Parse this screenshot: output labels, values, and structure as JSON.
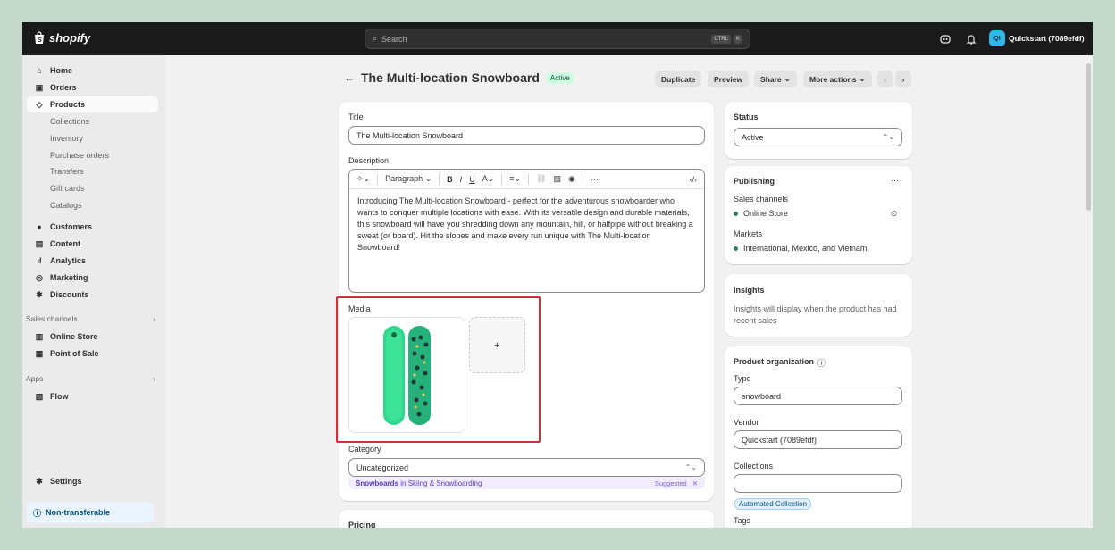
{
  "topbar": {
    "logo": "shopify",
    "search_placeholder": "Search",
    "shortcut_ctrl": "CTRL",
    "shortcut_k": "K",
    "store_initials": "QI",
    "store_name": "Quickstart (7089efdf)"
  },
  "sidebar": {
    "items": [
      {
        "label": "Home"
      },
      {
        "label": "Orders"
      },
      {
        "label": "Products"
      },
      {
        "label": "Collections"
      },
      {
        "label": "Inventory"
      },
      {
        "label": "Purchase orders"
      },
      {
        "label": "Transfers"
      },
      {
        "label": "Gift cards"
      },
      {
        "label": "Catalogs"
      },
      {
        "label": "Customers"
      },
      {
        "label": "Content"
      },
      {
        "label": "Analytics"
      },
      {
        "label": "Marketing"
      },
      {
        "label": "Discounts"
      }
    ],
    "sales_channels_label": "Sales channels",
    "channels": [
      "Online Store",
      "Point of Sale"
    ],
    "apps_label": "Apps",
    "apps": [
      "Flow"
    ],
    "settings": "Settings",
    "non_transferable": "Non-transferable"
  },
  "header": {
    "title": "The Multi-location Snowboard",
    "status_badge": "Active",
    "duplicate": "Duplicate",
    "preview": "Preview",
    "share": "Share",
    "more_actions": "More actions"
  },
  "product": {
    "title_label": "Title",
    "title_value": "The Multi-location Snowboard",
    "description_label": "Description",
    "toolbar_paragraph": "Paragraph",
    "description_text": "Introducing The Multi-location Snowboard - perfect for the adventurous snowboarder who wants to conquer multiple locations with ease. With its versatile design and durable materials, this snowboard will have you shredding down any mountain, hill, or halfpipe without breaking a sweat (or board). Hit the slopes and make every run unique with The Multi-location Snowboard!",
    "media_label": "Media",
    "media_add": "+",
    "category_label": "Category",
    "category_value": "Uncategorized",
    "suggest_link": "Snowboards",
    "suggest_rest": "in Skiing & Snowboarding",
    "suggested": "Suggested",
    "pricing_label": "Pricing"
  },
  "status_card": {
    "label": "Status",
    "value": "Active"
  },
  "publishing": {
    "label": "Publishing",
    "sales_channels": "Sales channels",
    "online_store": "Online Store",
    "markets": "Markets",
    "markets_value": "International, Mexico, and Vietnam"
  },
  "insights": {
    "label": "Insights",
    "text": "Insights will display when the product has had recent sales"
  },
  "organization": {
    "label": "Product organization",
    "type_label": "Type",
    "type_value": "snowboard",
    "vendor_label": "Vendor",
    "vendor_value": "Quickstart (7089efdf)",
    "collections_label": "Collections",
    "collection_pill": "Automated Collection",
    "tags_label": "Tags"
  },
  "colors": {
    "accent_green": "#29845a",
    "highlight_red": "#d82c3a",
    "topbar": "#1a1a1a"
  }
}
